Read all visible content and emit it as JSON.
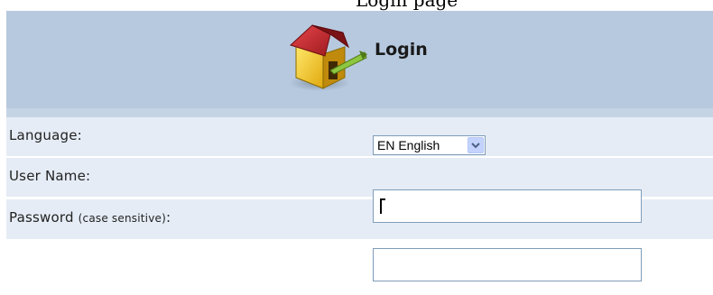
{
  "page": {
    "top_text": "Login page"
  },
  "header": {
    "title": "Login",
    "icon": "house-login-icon"
  },
  "form": {
    "language": {
      "label": "Language:",
      "selected": "EN English"
    },
    "username": {
      "label": "User Name:",
      "value": ""
    },
    "password": {
      "label_main": "Password",
      "label_note": "(case sensitive)",
      "label_colon": ":",
      "value": ""
    }
  },
  "colors": {
    "header_bg": "#b7c9de",
    "row_bg": "#e5ecf5",
    "input_border": "#7f9db9"
  }
}
